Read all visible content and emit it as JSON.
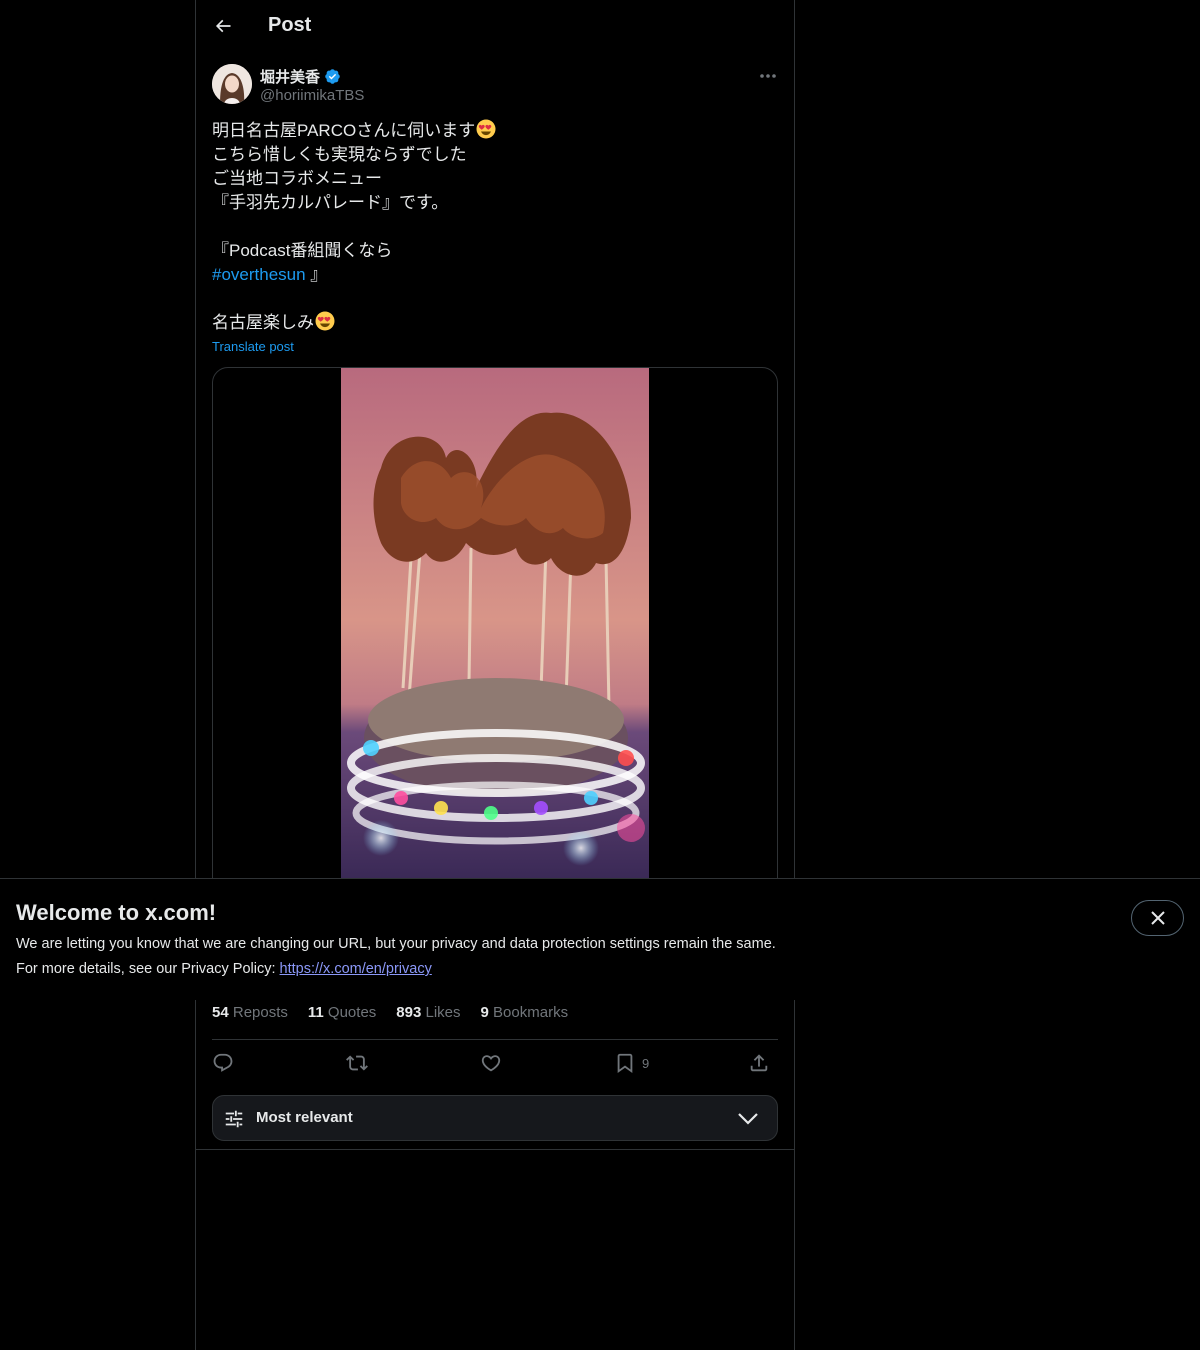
{
  "header": {
    "title": "Post"
  },
  "author": {
    "name": "堀井美香",
    "handle": "@horiimikaTBS",
    "verified": true,
    "verified_color": "#1d9bf0"
  },
  "post": {
    "lines": [
      "明日名古屋PARCOさんに伺います",
      "こちら惜しくも実現ならずでした",
      "ご当地コラボメニュー",
      "『手羽先カルパレード』です。",
      "『Podcast番組聞くなら",
      "#overthesun",
      " 』",
      "名古屋楽しみ"
    ],
    "emoji": "heart-eyes-emoji",
    "translate_label": "Translate post",
    "media_description_icon": "video-thumbnail"
  },
  "stats": {
    "reposts_count": "54",
    "reposts_label": "Reposts",
    "quotes_count": "11",
    "quotes_label": "Quotes",
    "likes_count": "893",
    "likes_label": "Likes",
    "bookmarks_count": "9",
    "bookmarks_label": "Bookmarks"
  },
  "actions": {
    "bookmark_count": "9"
  },
  "sort": {
    "label": "Most relevant"
  },
  "banner": {
    "title": "Welcome to x.com!",
    "line1": "We are letting you know that we are changing our URL, but your privacy and data protection settings remain the same.",
    "line2_prefix": "For more details, see our Privacy Policy: ",
    "link": "https://x.com/en/privacy"
  },
  "colors": {
    "background": "#000000",
    "text": "#e7e9ea",
    "muted": "#71767b",
    "accent": "#1d9bf0",
    "border": "#2f3336",
    "link_purple": "#8b98f8"
  }
}
